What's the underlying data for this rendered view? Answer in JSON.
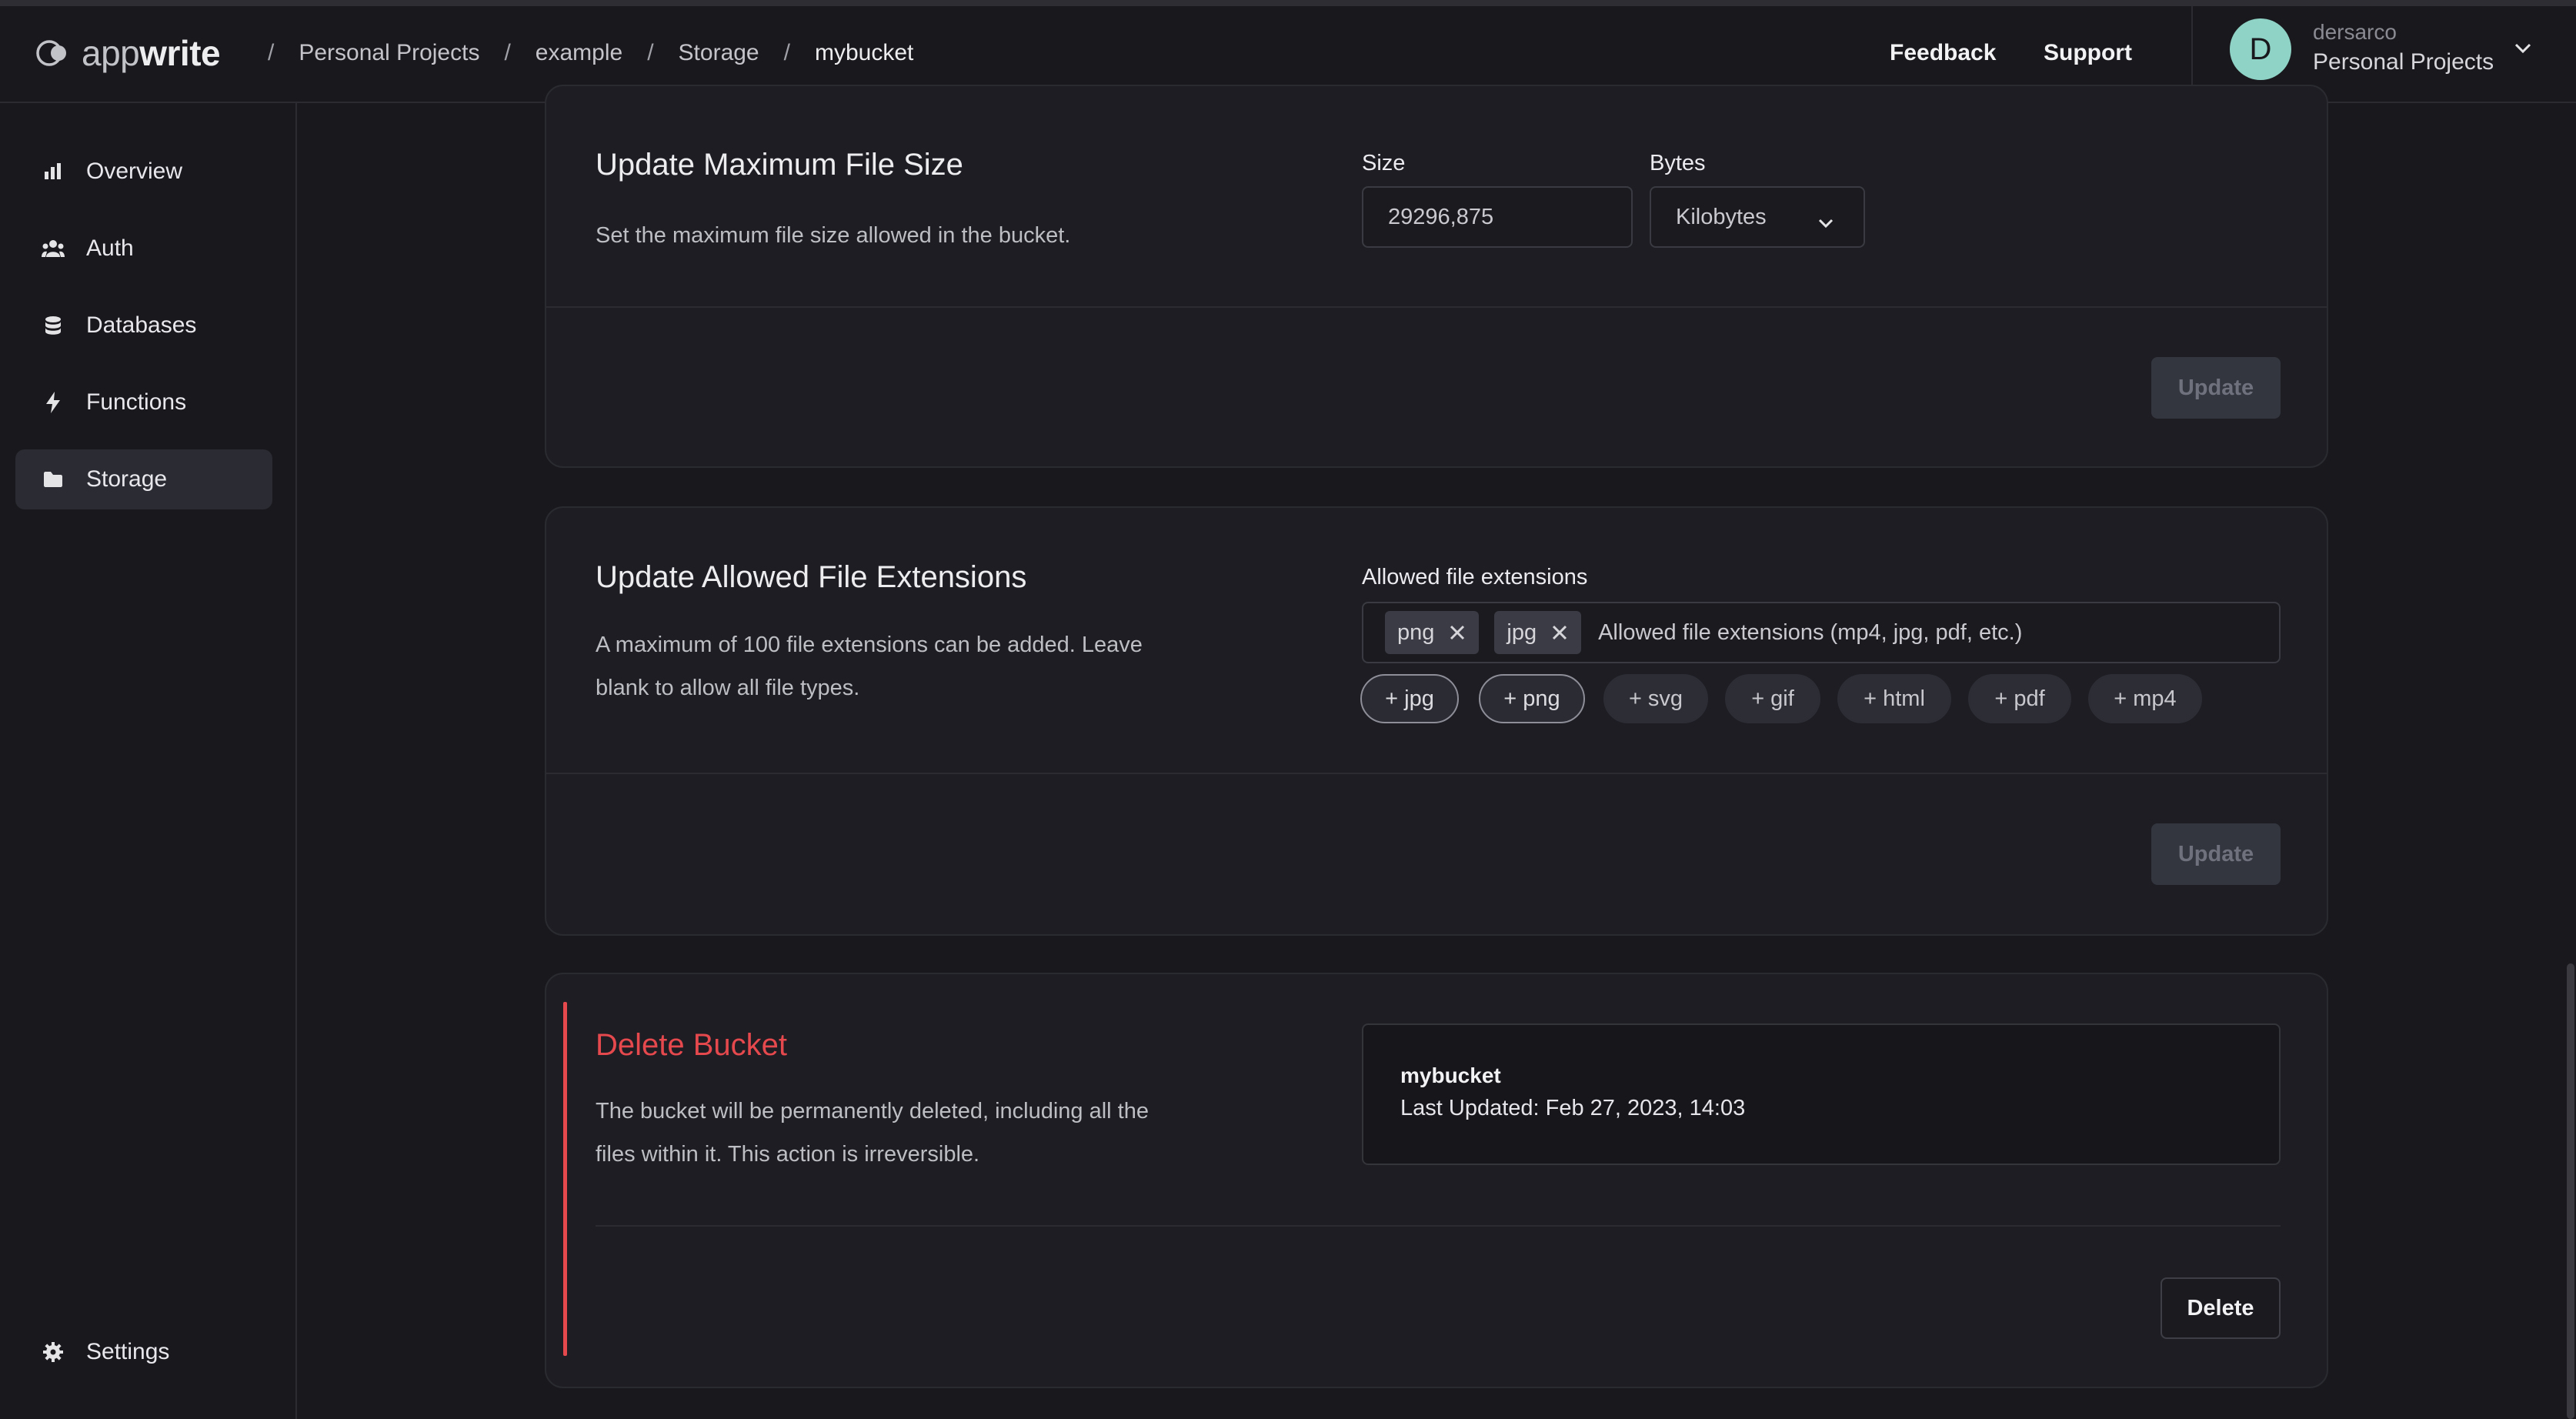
{
  "app": {
    "logo_light": "app",
    "logo_bold": "write"
  },
  "breadcrumbs": [
    "Personal Projects",
    "example",
    "Storage",
    "mybucket"
  ],
  "breadcrumb_separator": "/",
  "header": {
    "feedback": "Feedback",
    "support": "Support",
    "avatar_initial": "D",
    "user_name": "dersarco",
    "user_project": "Personal Projects"
  },
  "sidebar": {
    "items": [
      {
        "label": "Overview",
        "icon": "bar-chart-icon"
      },
      {
        "label": "Auth",
        "icon": "users-icon"
      },
      {
        "label": "Databases",
        "icon": "database-icon"
      },
      {
        "label": "Functions",
        "icon": "lightning-icon"
      },
      {
        "label": "Storage",
        "icon": "folder-icon",
        "active": true
      }
    ],
    "settings": {
      "label": "Settings",
      "icon": "gear-icon"
    }
  },
  "max_file_size": {
    "title": "Update Maximum File Size",
    "description": "Set the maximum file size allowed in the bucket.",
    "size_label": "Size",
    "size_value": "29296,875",
    "unit_label": "Bytes",
    "unit_value": "Kilobytes",
    "update_button": "Update"
  },
  "extensions": {
    "title": "Update Allowed File Extensions",
    "description": "A maximum of 100 file extensions can be added. Leave blank to allow all file types.",
    "field_label": "Allowed file extensions",
    "tags": [
      "png",
      "jpg"
    ],
    "placeholder": "Allowed file extensions (mp4, jpg, pdf, etc.)",
    "suggestions": [
      {
        "label": "+ jpg",
        "selected": true
      },
      {
        "label": "+ png",
        "selected": true
      },
      {
        "label": "+ svg",
        "selected": false
      },
      {
        "label": "+ gif",
        "selected": false
      },
      {
        "label": "+ html",
        "selected": false
      },
      {
        "label": "+ pdf",
        "selected": false
      },
      {
        "label": "+ mp4",
        "selected": false
      }
    ],
    "update_button": "Update"
  },
  "delete_bucket": {
    "title": "Delete Bucket",
    "description": "The bucket will be permanently deleted, including all the files within it. This action is irreversible.",
    "bucket_name": "mybucket",
    "last_updated": "Last Updated: Feb 27, 2023, 14:03",
    "delete_button": "Delete"
  },
  "colors": {
    "background": "#19191d",
    "card": "#1d1d23",
    "danger": "#e5484d",
    "avatar": "#8fd3c6"
  }
}
